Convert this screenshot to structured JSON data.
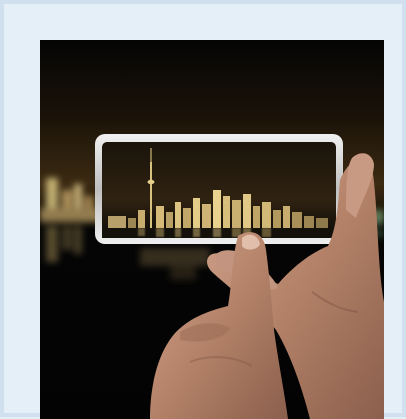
{
  "photo": {
    "subject": "hand-holding-phone-city-skyline",
    "colors": {
      "page_background": "#e4eff8",
      "frame_border": "#d0e0ee",
      "sky_top": "#060606",
      "sky_glow": "#3a2a10",
      "water": "#050505",
      "skyline_gold": "#d8c07a",
      "phone_frame": "#d9d9d9",
      "skin": "#b98872"
    }
  }
}
